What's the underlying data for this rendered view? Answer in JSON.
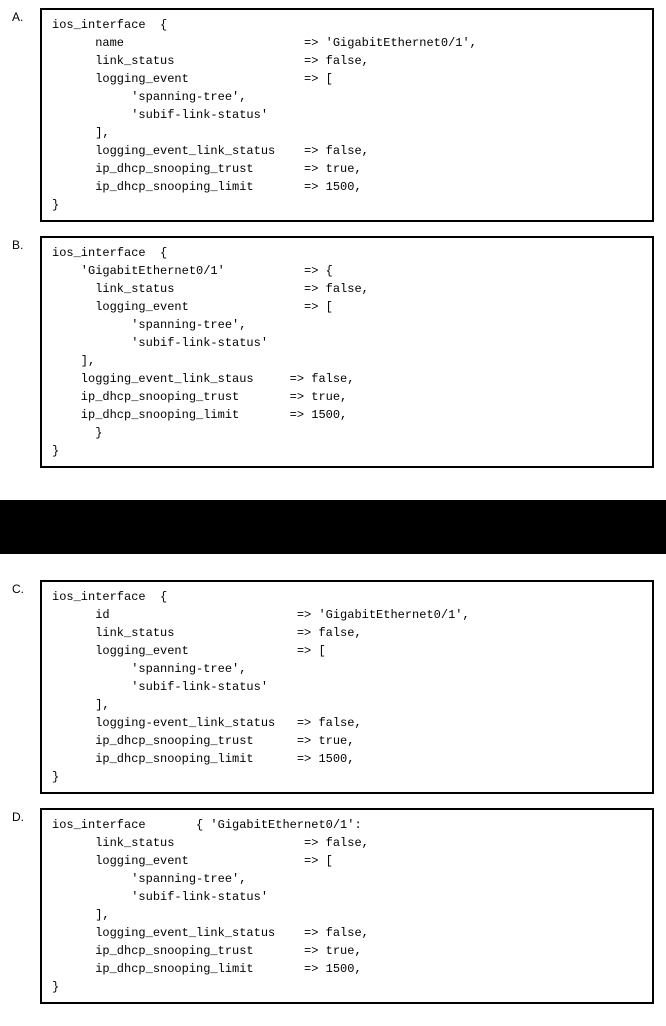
{
  "options": {
    "A": {
      "label": "A.",
      "code": "ios_interface  {\n      name                         => 'GigabitEthernet0/1',\n      link_status                  => false,\n      logging_event                => [\n           'spanning-tree',\n           'subif-link-status'\n      ],\n      logging_event_link_status    => false,\n      ip_dhcp_snooping_trust       => true,\n      ip_dhcp_snooping_limit       => 1500,\n}"
    },
    "B": {
      "label": "B.",
      "code": "ios_interface  {\n    'GigabitEthernet0/1'           => {\n      link_status                  => false,\n      logging_event                => [\n           'spanning-tree',\n           'subif-link-status'\n    ],\n    logging_event_link_staus     => false,\n    ip_dhcp_snooping_trust       => true,\n    ip_dhcp_snooping_limit       => 1500,\n      }\n}"
    },
    "C": {
      "label": "C.",
      "code": "ios_interface  {\n      id                          => 'GigabitEthernet0/1',\n      link_status                 => false,\n      logging_event               => [\n           'spanning-tree',\n           'subif-link-status'\n      ],\n      logging-event_link_status   => false,\n      ip_dhcp_snooping_trust      => true,\n      ip_dhcp_snooping_limit      => 1500,\n}"
    },
    "D": {
      "label": "D.",
      "code": "ios_interface       { 'GigabitEthernet0/1':\n      link_status                  => false,\n      logging_event                => [\n           'spanning-tree',\n           'subif-link-status'\n      ],\n      logging_event_link_status    => false,\n      ip_dhcp_snooping_trust       => true,\n      ip_dhcp_snooping_limit       => 1500,\n}"
    }
  }
}
